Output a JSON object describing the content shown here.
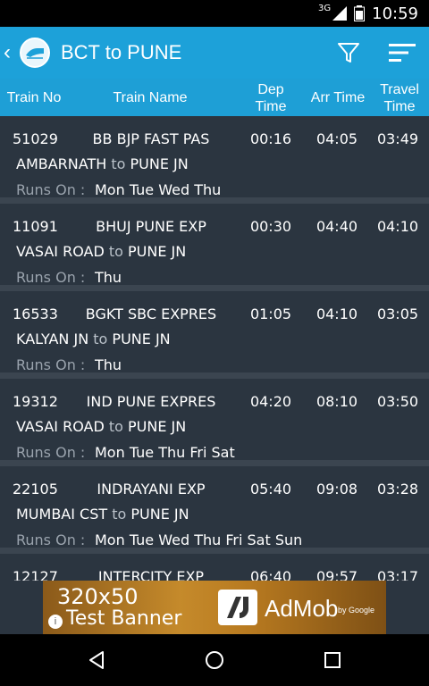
{
  "status_bar": {
    "network": "3G",
    "time": "10:59"
  },
  "app_bar": {
    "title": "BCT to PUNE"
  },
  "columns": {
    "train_no": "Train No",
    "train_name": "Train Name",
    "dep_time_1": "Dep",
    "dep_time_2": "Time",
    "arr_time": "Arr Time",
    "travel_time_1": "Travel",
    "travel_time_2": "Time"
  },
  "runs_on_label": "Runs On :",
  "to_word": "to",
  "trains": [
    {
      "no": "51029",
      "name": "BB BJP FAST PAS",
      "dep": "00:16",
      "arr": "04:05",
      "travel": "03:49",
      "from": "AMBARNATH",
      "dest": "PUNE JN",
      "days": "Mon Tue Wed Thu"
    },
    {
      "no": "11091",
      "name": "BHUJ PUNE EXP",
      "dep": "00:30",
      "arr": "04:40",
      "travel": "04:10",
      "from": "VASAI ROAD",
      "dest": "PUNE JN",
      "days": "Thu"
    },
    {
      "no": "16533",
      "name": "BGKT SBC EXPRES",
      "dep": "01:05",
      "arr": "04:10",
      "travel": "03:05",
      "from": "KALYAN JN",
      "dest": "PUNE JN",
      "days": "Thu"
    },
    {
      "no": "19312",
      "name": "IND PUNE EXPRES",
      "dep": "04:20",
      "arr": "08:10",
      "travel": "03:50",
      "from": "VASAI ROAD",
      "dest": "PUNE JN",
      "days": "Mon Tue Thu Fri Sat"
    },
    {
      "no": "22105",
      "name": "INDRAYANI EXP",
      "dep": "05:40",
      "arr": "09:08",
      "travel": "03:28",
      "from": "MUMBAI CST",
      "dest": "PUNE JN",
      "days": "Mon Tue Wed Thu Fri Sat Sun"
    },
    {
      "no": "12127",
      "name": "INTERCITY EXP",
      "dep": "06:40",
      "arr": "09:57",
      "travel": "03:17",
      "from": "",
      "dest": "",
      "days": ""
    }
  ],
  "ad": {
    "size": "320x50",
    "label": "Test Banner",
    "brand": "AdMob",
    "by": "by Google"
  },
  "colors": {
    "app_bar": "#1da1d9",
    "background": "#2b3540",
    "separator": "#3b4550"
  }
}
